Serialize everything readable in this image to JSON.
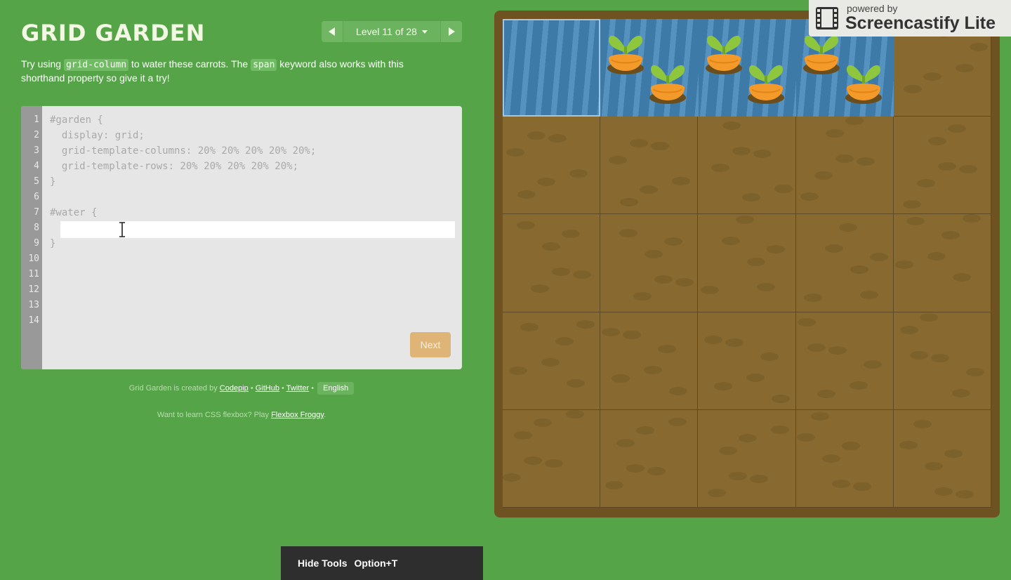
{
  "header": {
    "title": "GRID GARDEN",
    "level_label": "Level 11 of 28"
  },
  "instructions": {
    "part1": "Try using ",
    "code1": "grid-column",
    "part2": " to water these carrots. The ",
    "code2": "span",
    "part3": " keyword also works with this shorthand property so give it a try!"
  },
  "editor": {
    "line_numbers": [
      "1",
      "2",
      "3",
      "4",
      "5",
      "6",
      "7",
      "8",
      "9",
      "10",
      "11",
      "12",
      "13",
      "14"
    ],
    "lines": [
      "#garden {",
      "  display: grid;",
      "  grid-template-columns: 20% 20% 20% 20% 20%;",
      "  grid-template-rows: 20% 20% 20% 20% 20%;",
      "}",
      "",
      "#water {",
      "",
      "}"
    ],
    "input_value": "",
    "next_label": "Next"
  },
  "footer": {
    "credit_prefix": "Grid Garden is created by ",
    "codepip": "Codepip",
    "sep": " • ",
    "github": "GitHub",
    "twitter": "Twitter",
    "language": "English",
    "flexbox_prefix": "Want to learn CSS flexbox? Play ",
    "flexbox_link": "Flexbox Froggy",
    "flexbox_suffix": "."
  },
  "garden": {
    "rows": 5,
    "columns": 5,
    "water_columns": 4,
    "carrot_cells": [
      2,
      3,
      4
    ]
  },
  "recorder": {
    "small": "powered by",
    "big": "Screencastify Lite",
    "icon": "film-strip-icon"
  },
  "toolbar": {
    "hide_label": "Hide Tools",
    "shortcut": "Option+T"
  },
  "colors": {
    "background": "#55a447",
    "soil": "#886a30",
    "water": "#3e7aa8",
    "carrot": "#f39a2b",
    "leaf": "#8ec73e",
    "next_button": "#dfb577"
  }
}
